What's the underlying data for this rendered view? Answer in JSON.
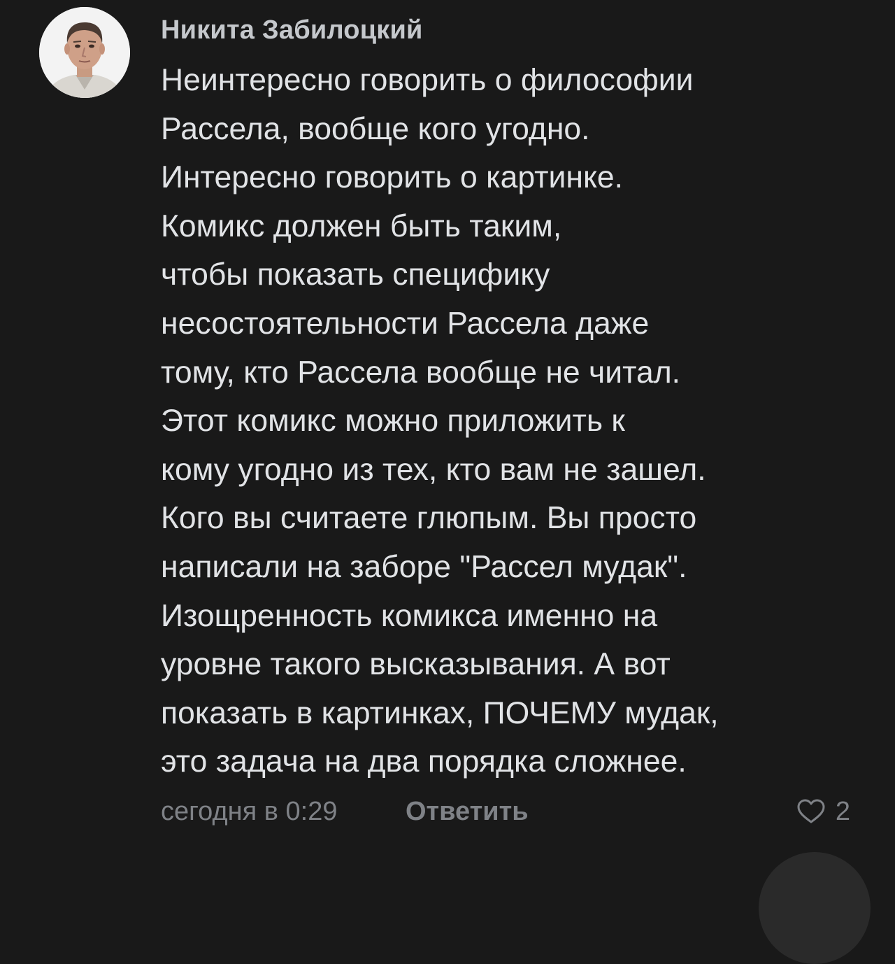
{
  "comment": {
    "author": "Никита Забилоцкий",
    "avatar_icon": "user-photo-avatar",
    "lines": [
      "Неинтересно говорить о философии",
      "Рассела, вообще кого угодно.",
      "Интересно говорить о картинке.",
      "Комикс должен быть таким,",
      "чтобы показать специфику",
      "несостоятельности Рассела даже",
      "тому, кто Рассела вообще не читал.",
      "Этот комикс можно приложить к",
      "кому угодно из тех, кто вам не зашел.",
      "Кого вы считаете глюпым. Вы просто",
      "написали на заборе \"Рассел мудак\".",
      "Изощренность комикса именно на",
      "уровне такого высказывания. А вот",
      "показать в картинках, ПОЧЕМУ мудак,",
      "это задача на два порядка сложнее."
    ],
    "timestamp": "сегодня в 0:29",
    "reply_label": "Ответить",
    "like_icon": "heart-outline-icon",
    "like_count": "2"
  },
  "colors": {
    "background": "#191919",
    "text": "#e1e3e6",
    "secondary": "#7f8287"
  }
}
